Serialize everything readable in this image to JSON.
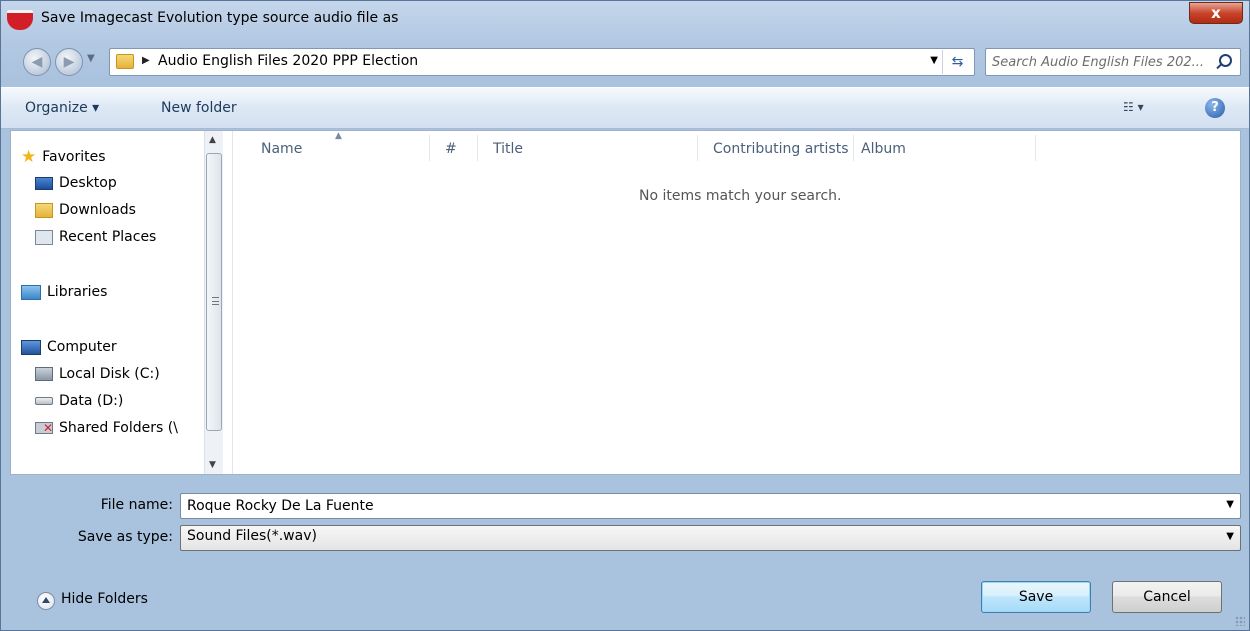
{
  "window": {
    "title": "Save Imagecast Evolution type source audio file as",
    "close_label": "x"
  },
  "address": {
    "path": "Audio English Files 2020 PPP Election",
    "search_placeholder": "Search Audio English Files 202..."
  },
  "toolbar": {
    "organize_label": "Organize ▾",
    "new_folder_label": "New folder",
    "help_label": "?"
  },
  "nav": {
    "favorites": "Favorites",
    "desktop": "Desktop",
    "downloads": "Downloads",
    "recent_places": "Recent Places",
    "libraries": "Libraries",
    "computer": "Computer",
    "local_disk": "Local Disk (C:)",
    "data_drive": "Data (D:)",
    "shared_folders": "Shared Folders (\\"
  },
  "columns": {
    "name": "Name",
    "number": "#",
    "title": "Title",
    "contributing_artists": "Contributing artists",
    "album": "Album"
  },
  "content": {
    "empty_message": "No items match your search."
  },
  "form": {
    "file_name_label": "File name:",
    "file_name_value": "Roque Rocky De La Fuente",
    "save_type_label": "Save as type:",
    "save_type_value": "Sound Files(*.wav)"
  },
  "footer": {
    "hide_folders_label": "Hide Folders",
    "save_label": "Save",
    "cancel_label": "Cancel"
  }
}
